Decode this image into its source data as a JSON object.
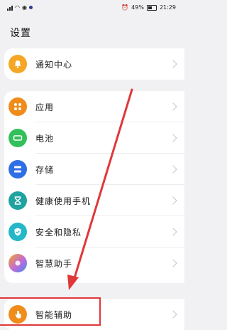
{
  "status": {
    "battery": "49%",
    "time": "21:29"
  },
  "title": "设置",
  "groups": [
    {
      "items": [
        {
          "label": "通知中心",
          "icon": "bell-icon",
          "color": "#f5a623"
        }
      ]
    },
    {
      "items": [
        {
          "label": "应用",
          "icon": "apps-icon",
          "color": "#f08c1b"
        },
        {
          "label": "电池",
          "icon": "battery-icon",
          "color": "#33c05a"
        },
        {
          "label": "存储",
          "icon": "storage-icon",
          "color": "#2f6fe6"
        },
        {
          "label": "健康使用手机",
          "icon": "hourglass-icon",
          "color": "#1fa3a0"
        },
        {
          "label": "安全和隐私",
          "icon": "shield-icon",
          "color": "#23b7c8"
        },
        {
          "label": "智慧助手",
          "icon": "assistant-icon",
          "color": "#c06ad8"
        }
      ]
    },
    {
      "items": [
        {
          "label": "智能辅助",
          "icon": "hand-icon",
          "color": "#f08c1b"
        }
      ]
    }
  ],
  "colors": {
    "annotation": "#e0383a",
    "background": "#f1f1f3"
  }
}
